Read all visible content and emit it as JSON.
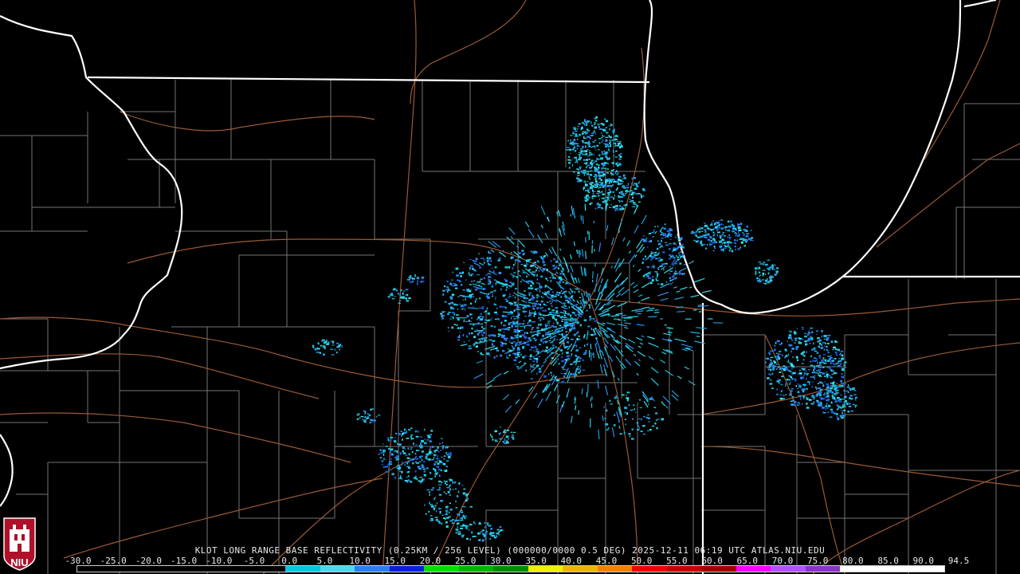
{
  "caption": "KLOT LONG RANGE BASE REFLECTIVITY (0.25KM / 256 LEVEL) (000000/0000 0.5 DEG) 2025-12-11 06:19 UTC  ATLAS.NIU.EDU",
  "scale": {
    "labels": [
      "-30.0",
      "-25.0",
      "-20.0",
      "-15.0",
      "-10.0",
      "-5.0",
      "0.0",
      "5.0",
      "10.0",
      "15.0",
      "20.0",
      "25.0",
      "30.0",
      "35.0",
      "40.0",
      "45.0",
      "50.0",
      "55.0",
      "60.0",
      "65.0",
      "70.0",
      "75.0",
      "80.0",
      "85.0",
      "90.0",
      "94.5"
    ],
    "colors": [
      "#000000",
      "#000000",
      "#000000",
      "#000000",
      "#000000",
      "#000000",
      "#00c8dc",
      "#4fd6f0",
      "#2a7ff0",
      "#0a1fd8",
      "#00e000",
      "#00b400",
      "#008c00",
      "#f0f000",
      "#f0b400",
      "#f08200",
      "#f00000",
      "#c80000",
      "#a00000",
      "#ff00ff",
      "#b450ff",
      "#8c32c8",
      "#ffffff",
      "#ffffff",
      "#ffffff"
    ]
  },
  "logo": {
    "text": "NIU",
    "name": "niu-logo-icon"
  },
  "map": {
    "radar_site": "KLOT",
    "features": [
      "state-borders",
      "county-borders",
      "highways",
      "lake-michigan-shoreline",
      "mississippi-river"
    ]
  }
}
